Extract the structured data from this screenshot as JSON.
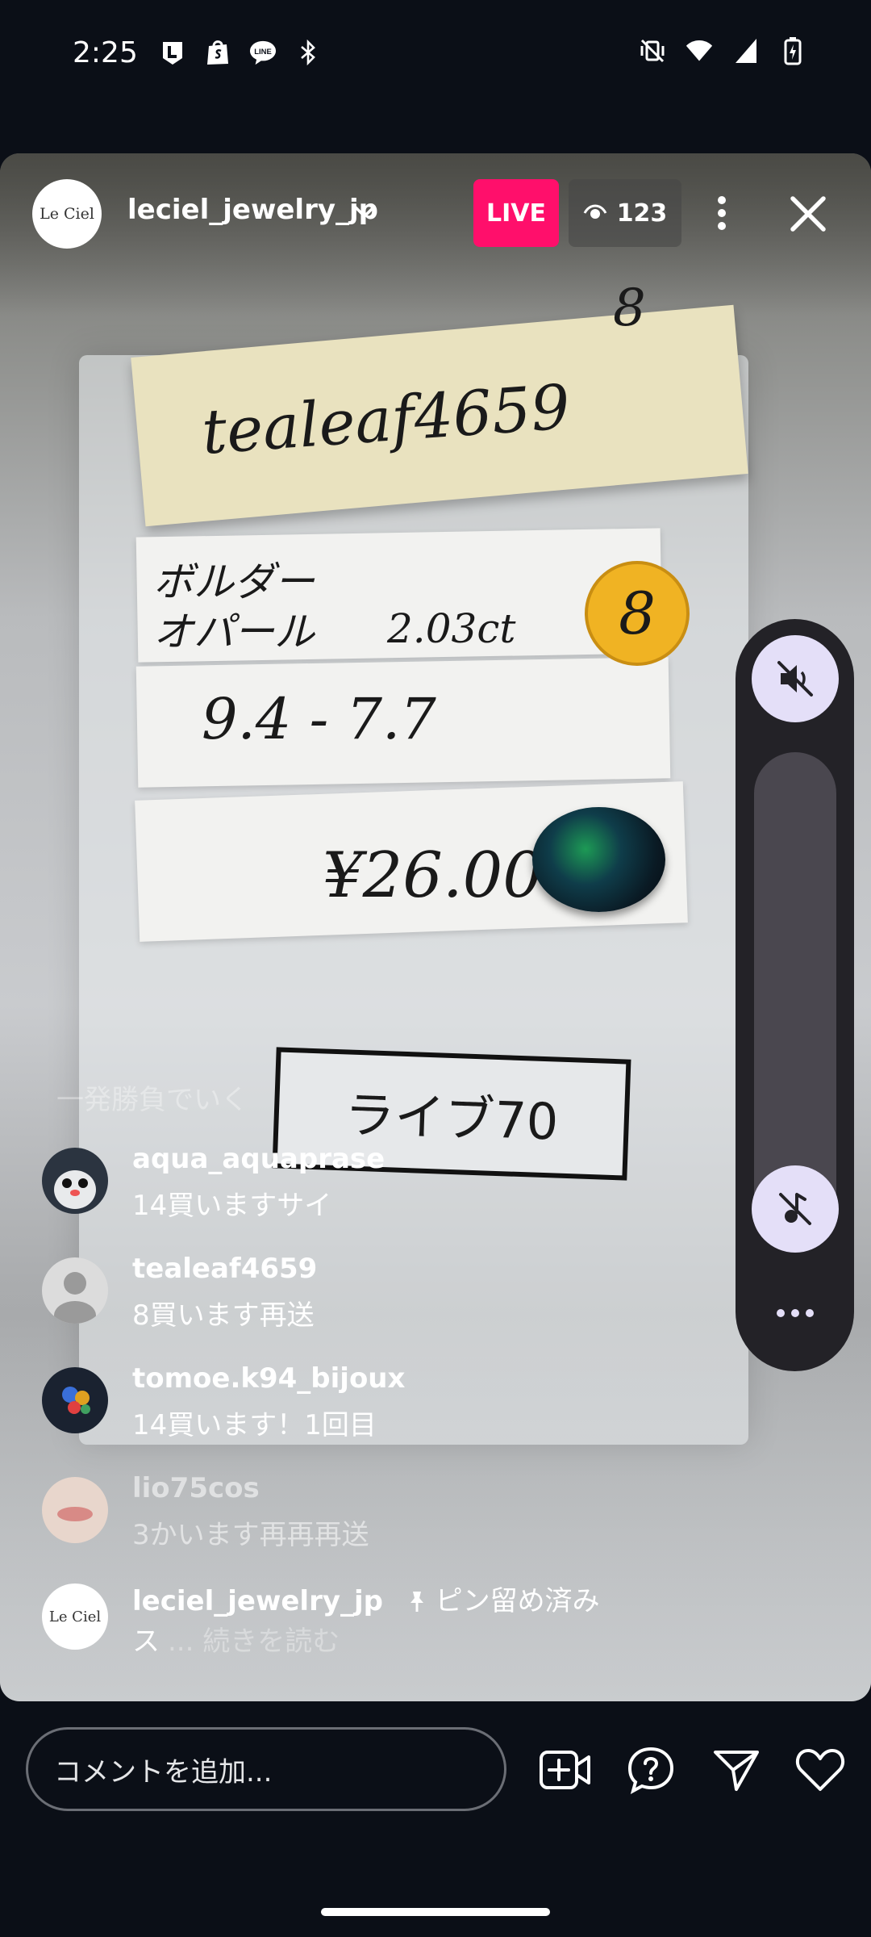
{
  "status_bar": {
    "time": "2:25",
    "left_icons": [
      "l-app-icon",
      "shopify-icon",
      "line-icon",
      "bluetooth-icon"
    ],
    "right_icons": [
      "vibrate-mute-icon",
      "wifi-icon",
      "signal-icon",
      "battery-charging-icon"
    ]
  },
  "live_header": {
    "avatar_text": "Le Ciel",
    "username": "leciel_jewelry_jp",
    "live_label": "LIVE",
    "viewer_count": "123"
  },
  "video": {
    "note_text": "tealeaf4659",
    "note_number": "8",
    "card_name": "ボルダー\nオパール",
    "card_carat": "2.03ct",
    "card_size": "9.4 - 7.7",
    "card_price": "¥26.000",
    "dot_number": "8",
    "tag_text": "ライブ70"
  },
  "comments": {
    "faded": "一発勝負でいく",
    "items": [
      {
        "user": "aqua_aquaprase",
        "text": "14買いますサイ"
      },
      {
        "user": "tealeaf4659",
        "text": "8買います再送"
      },
      {
        "user": "tomoe.k94_bijoux",
        "text": "14買います！1回目"
      },
      {
        "user": "lio75cos",
        "text": "3かいます再再再送"
      },
      {
        "user": "leciel_jewelry_jp",
        "pin_label": "ピン留め済み",
        "text": "ス",
        "read_more": "... 続きを読む"
      }
    ]
  },
  "input": {
    "placeholder": "コメントを追加..."
  },
  "colors": {
    "live_badge": "#ff0f6b",
    "panel_bg": "#232227",
    "panel_button": "#e4dff8",
    "background": "#0b0f17"
  }
}
